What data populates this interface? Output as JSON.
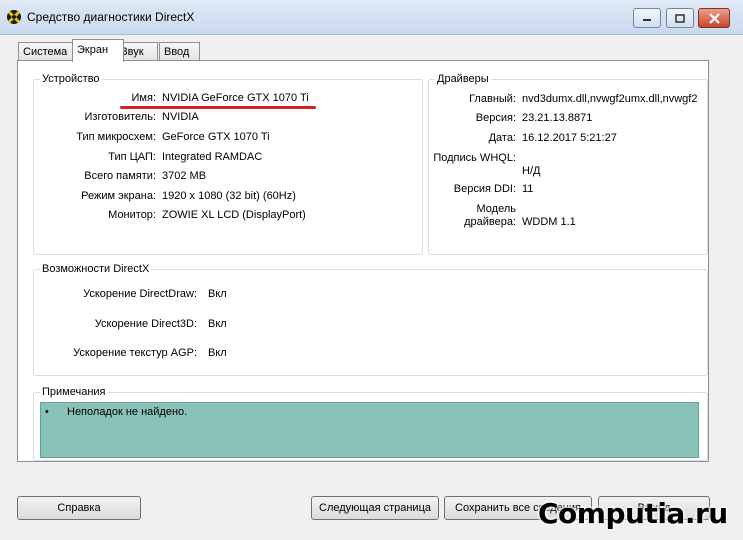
{
  "window": {
    "title": "Средство диагностики DirectX"
  },
  "tabs": [
    {
      "label": "Система"
    },
    {
      "label": "Экран"
    },
    {
      "label": "Звук"
    },
    {
      "label": "Ввод"
    }
  ],
  "device": {
    "title": "Устройство",
    "rows": [
      {
        "label": "Имя:",
        "value": "NVIDIA GeForce GTX 1070 Ti"
      },
      {
        "label": "Изготовитель:",
        "value": "NVIDIA"
      },
      {
        "label": "Тип микросхем:",
        "value": "GeForce GTX 1070 Ti"
      },
      {
        "label": "Тип ЦАП:",
        "value": "Integrated RAMDAC"
      },
      {
        "label": "Всего памяти:",
        "value": "3702 MB"
      },
      {
        "label": "Режим экрана:",
        "value": "1920 x 1080 (32 bit) (60Hz)"
      },
      {
        "label": "Монитор:",
        "value": "ZOWIE XL LCD (DisplayPort)"
      }
    ]
  },
  "drivers": {
    "title": "Драйверы",
    "rows": [
      {
        "label": "Главный:",
        "value": "nvd3dumx.dll,nvwgf2umx.dll,nvwgf2"
      },
      {
        "label": "Версия:",
        "value": "23.21.13.8871"
      },
      {
        "label": "Дата:",
        "value": "16.12.2017 5:21:27"
      },
      {
        "label": "Подпись WHQL:",
        "value": "Н/Д"
      },
      {
        "label": "Версия DDI:",
        "value": "11"
      },
      {
        "label_line1": "Модель",
        "label_line2": "драйвера:",
        "value": "WDDM 1.1"
      }
    ]
  },
  "features": {
    "title": "Возможности DirectX",
    "rows": [
      {
        "label": "Ускорение DirectDraw:",
        "value": "Вкл"
      },
      {
        "label": "Ускорение Direct3D:",
        "value": "Вкл"
      },
      {
        "label": "Ускорение текстур AGP:",
        "value": "Вкл"
      }
    ]
  },
  "notes": {
    "title": "Примечания",
    "bullet": "•",
    "items": [
      "Неполадок не найдено."
    ]
  },
  "buttons": {
    "help": "Справка",
    "next_page": "Следующая страница",
    "save_all": "Сохранить все сведения",
    "exit": "Выход"
  },
  "watermark": "Computia.ru",
  "colors": {
    "notes_bg": "#88c2b8",
    "highlight_line": "#d42020"
  }
}
